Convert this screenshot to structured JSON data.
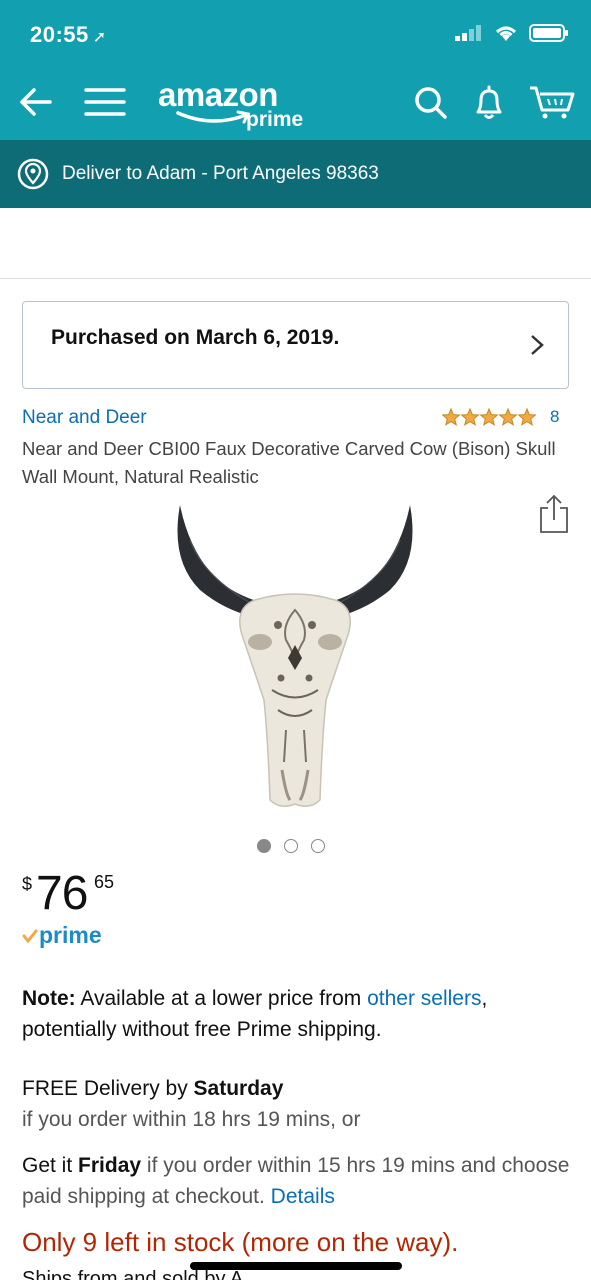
{
  "status": {
    "time": "20:55",
    "signal": "signal-icon",
    "wifi": "wifi-icon",
    "battery": "battery-icon"
  },
  "nav": {
    "logo_main": "amazon",
    "logo_sub": "prime",
    "icons": [
      "back-arrow-icon",
      "hamburger-menu-icon",
      "search-icon",
      "bell-icon",
      "cart-icon"
    ]
  },
  "deliver": {
    "text": "Deliver to Adam - Port Angeles 98363"
  },
  "purchased": {
    "text": "Purchased on March 6, 2019."
  },
  "product": {
    "brand": "Near and Deer",
    "rating_count": "8",
    "title": "Near and Deer CBI00 Faux Decorative Carved Cow (Bison) Skull Wall Mount, Natural Realistic"
  },
  "price": {
    "symbol": "$",
    "dollars": "76",
    "cents": "65",
    "prime_label": "prime"
  },
  "note": {
    "label": "Note:",
    "text_before": " Available at a lower price from ",
    "link": "other sellers",
    "text_after": ", potentially without free Prime shipping."
  },
  "delivery": {
    "line1_prefix": "FREE Delivery by ",
    "line1_day": "Saturday",
    "line2": "if you order within 18 hrs 19 mins, or"
  },
  "paid": {
    "prefix": "Get it ",
    "day": "Friday",
    "text": " if you order within 15 hrs 19 mins and choose paid shipping at checkout. ",
    "link": "Details"
  },
  "stock": {
    "text": "Only 9 left in stock (more on the way)."
  },
  "cutoff": {
    "text": "Ships from and sold by A..."
  },
  "colors": {
    "header_teal": "#12a0b0",
    "deliver_teal": "#0e6c76",
    "link_blue": "#0a6fb6",
    "stock_red": "#b12704",
    "star_orange": "#f3a847"
  }
}
